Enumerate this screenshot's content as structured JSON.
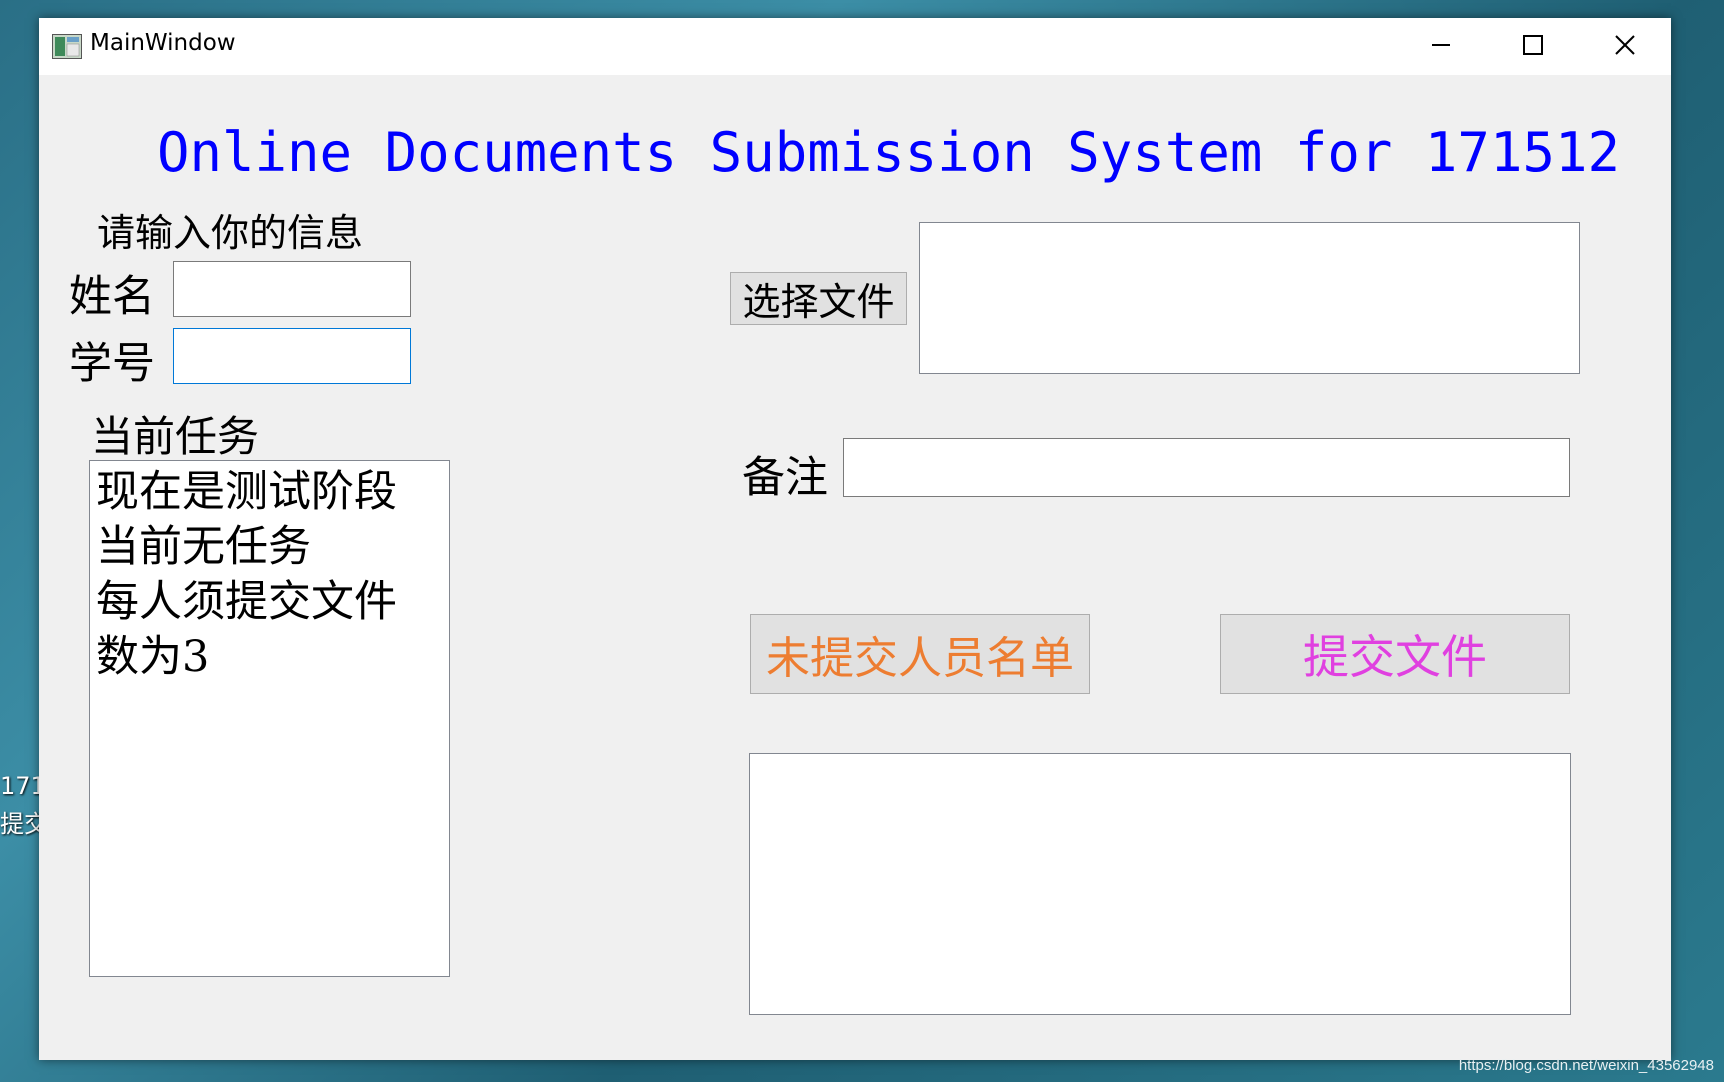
{
  "window": {
    "title": "MainWindow",
    "controls": {
      "minimize": "minimize",
      "maximize": "maximize",
      "close": "close"
    }
  },
  "main": {
    "heading": "Online Documents Submission System for 171512",
    "info_prompt": "请输入你的信息",
    "name_label": "姓名",
    "name_value": "",
    "student_id_label": "学号",
    "student_id_value": "",
    "current_task_label": "当前任务",
    "task_lines": [
      "现在是测试阶段",
      "当前无任务",
      "每人须提交文件",
      "数为3"
    ],
    "choose_file_button": "选择文件",
    "file_path_value": "",
    "remark_label": "备注",
    "remark_value": "",
    "unsubmitted_list_button": "未提交人员名单",
    "submit_button": "提交文件",
    "output_value": ""
  },
  "desktop": {
    "side_text_1": "171",
    "side_text_2": "提交",
    "watermark": "https://blog.csdn.net/weixin_43562948"
  },
  "colors": {
    "heading": "#0000ff",
    "unsubmitted_button_text": "#ed7d31",
    "submit_button_text": "#e040e0",
    "focus_border": "#0078d7"
  },
  "icons": {
    "app": "app-window-icon",
    "minimize": "minimize-icon",
    "maximize": "maximize-icon",
    "close": "close-icon"
  }
}
